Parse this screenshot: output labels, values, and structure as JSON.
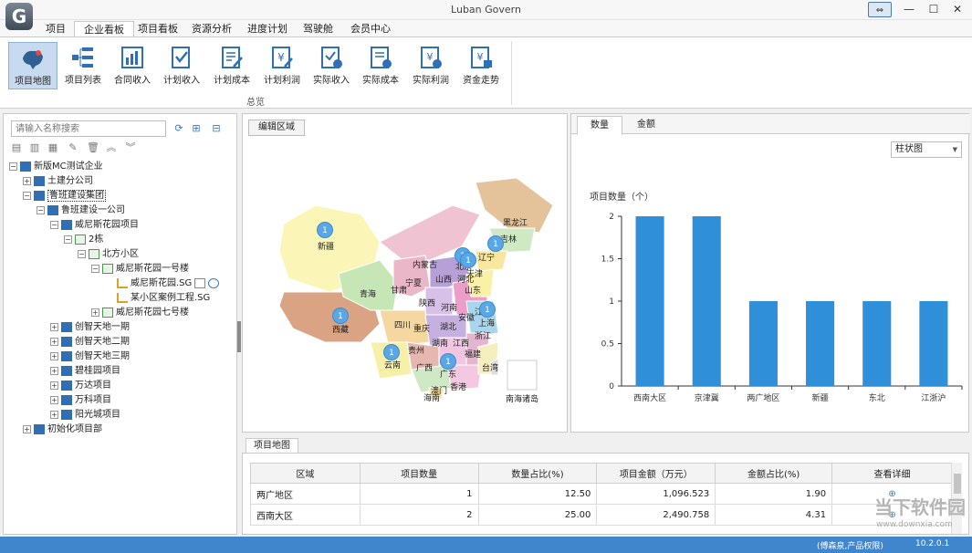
{
  "window": {
    "title": "Luban Govern",
    "logo_letter": "G"
  },
  "menu": {
    "tabs": [
      "项目",
      "企业看板",
      "项目看板",
      "资源分析",
      "进度计划",
      "驾驶舱",
      "会员中心"
    ]
  },
  "ribbon": {
    "buttons": [
      "项目地图",
      "项目列表",
      "合同收入",
      "计划收入",
      "计划成本",
      "计划利润",
      "实际收入",
      "实际成本",
      "实际利润",
      "资金走势"
    ],
    "group_label": "总览"
  },
  "sidebar": {
    "search_placeholder": "请输入名称搜索",
    "tree": [
      "新版MC测试企业",
      "土建分公司",
      "鲁班建设集团",
      "鲁班建设一公司",
      "威尼斯花园项目",
      "2栋",
      "北方小区",
      "威尼斯花园一号楼",
      "威尼斯花园.SG",
      "某小区案例工程.SG",
      "威尼斯花园七号楼",
      "创智天地一期",
      "创智天地二期",
      "创智天地三期",
      "碧桂园项目",
      "万达项目",
      "万科项目",
      "阳光城项目",
      "初始化项目部"
    ]
  },
  "map": {
    "edit_label": "编辑区域",
    "provinces": [
      "黑龙江",
      "吉林",
      "辽宁",
      "内蒙古",
      "北京",
      "天津",
      "河北",
      "山西",
      "山东",
      "宁夏",
      "甘肃",
      "青海",
      "新疆",
      "西藏",
      "陕西",
      "河南",
      "江苏",
      "安徽",
      "上海",
      "四川",
      "重庆",
      "湖北",
      "浙江",
      "贵州",
      "湖南",
      "江西",
      "福建",
      "云南",
      "广西",
      "广东",
      "台湾",
      "香港",
      "澳门",
      "海南",
      "南海诸岛"
    ],
    "pins": [
      "1",
      "1",
      "1",
      "1",
      "1",
      "1",
      "1",
      "1"
    ]
  },
  "chart": {
    "tabs": [
      "数量",
      "金额"
    ],
    "chart_type_select": "柱状图"
  },
  "chart_data": {
    "type": "bar",
    "categories": [
      "西南大区",
      "京津冀",
      "两广地区",
      "新疆",
      "东北",
      "江浙沪"
    ],
    "values": [
      2,
      2,
      1,
      1,
      1,
      1
    ],
    "title": "",
    "xlabel": "",
    "ylabel": "项目数量（个）",
    "ylim": [
      0,
      2
    ],
    "yticks": [
      "0",
      "0.5",
      "1",
      "1.5",
      "2"
    ],
    "color": "#2f8fd8"
  },
  "table": {
    "tab_label": "项目地图",
    "columns": [
      "区域",
      "项目数量",
      "数量占比(%)",
      "项目金额（万元）",
      "金额占比(%)",
      "查看详细"
    ],
    "rows": [
      [
        "两广地区",
        "1",
        "12.50",
        "1,096.523",
        "1.90"
      ],
      [
        "西南大区",
        "2",
        "25.00",
        "2,490.758",
        "4.31"
      ]
    ]
  },
  "status": {
    "user": "(傅森泉,产品权限)",
    "version": "10.2.0.1"
  },
  "watermark": {
    "main": "当下软件园",
    "sub": "www.downxia.com"
  }
}
